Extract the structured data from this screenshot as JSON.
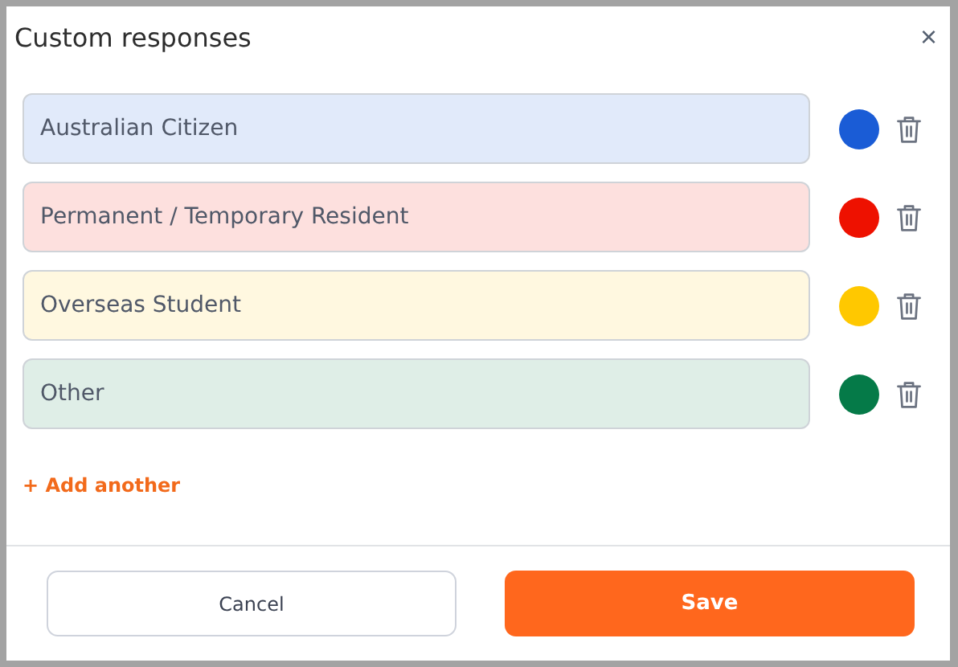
{
  "dialog": {
    "title": "Custom responses",
    "close": "×"
  },
  "responses": [
    {
      "value": "Australian Citizen",
      "color": "#1a5cd6"
    },
    {
      "value": "Permanent / Temporary Resident",
      "color": "#ee1100"
    },
    {
      "value": "Overseas Student",
      "color": "#ffc800"
    },
    {
      "value": "Other",
      "color": "#057a48"
    }
  ],
  "add_link": "+ Add another",
  "buttons": {
    "cancel": "Cancel",
    "save": "Save"
  }
}
